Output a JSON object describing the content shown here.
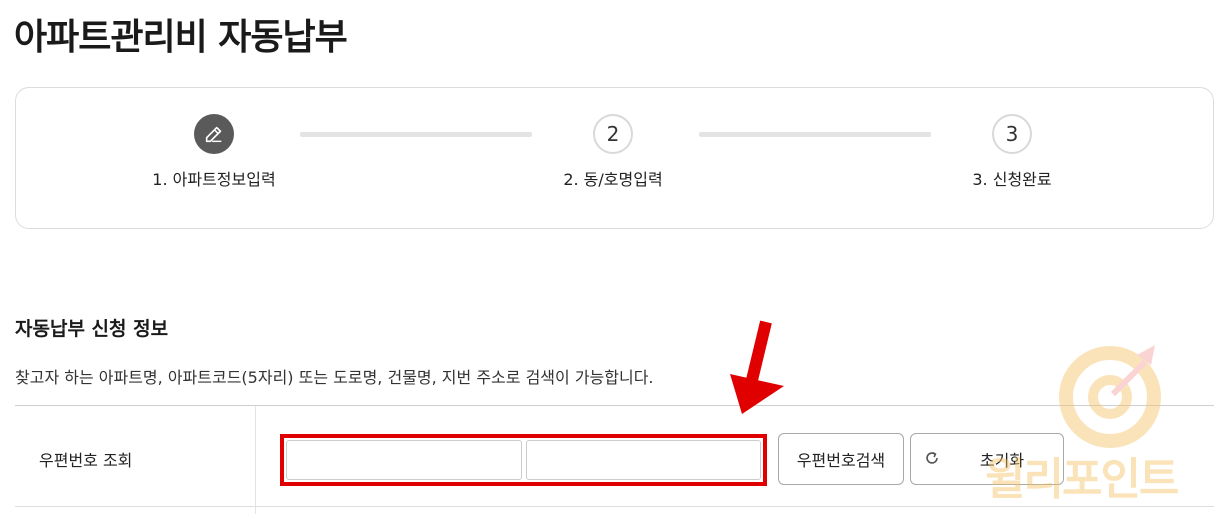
{
  "page": {
    "title": "아파트관리비 자동납부"
  },
  "steps": [
    {
      "number": "1",
      "label": "1. 아파트정보입력",
      "icon": "pencil-icon",
      "active": true
    },
    {
      "number": "2",
      "label": "2. 동/호명입력",
      "active": false
    },
    {
      "number": "3",
      "label": "3. 신청완료",
      "active": false
    }
  ],
  "section": {
    "title": "자동납부 신청 정보",
    "description": "찾고자 하는 아파트명, 아파트코드(5자리) 또는 도로명, 건물명, 지번 주소로 검색이 가능합니다."
  },
  "form": {
    "zip_label": "우편번호 조회",
    "zip_input_1": {
      "value": "",
      "placeholder": ""
    },
    "zip_input_2": {
      "value": "",
      "placeholder": ""
    },
    "search_button": "우편번호검색",
    "reset_button": "초기화"
  },
  "watermark": {
    "text": "윌리포인트"
  },
  "colors": {
    "accent_red": "#e00000",
    "active_step": "#5a5a5a",
    "watermark_orange": "#f5a623"
  }
}
